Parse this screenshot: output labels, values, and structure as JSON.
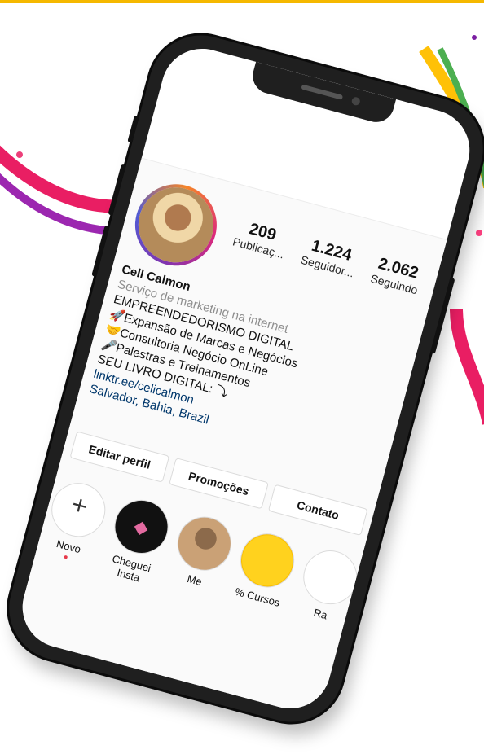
{
  "colors": {
    "border": "#f5b800",
    "phone": "#1f1f1f",
    "link": "#00376b",
    "muted": "#8e8e8e"
  },
  "profile": {
    "stats": [
      {
        "value": "209",
        "label": "Publicaç..."
      },
      {
        "value": "1.224",
        "label": "Seguidor..."
      },
      {
        "value": "2.062",
        "label": "Seguindo"
      }
    ],
    "name": "Cell Calmon",
    "category": "Serviço de marketing na internet",
    "bio_lines": [
      "EMPREENDEDORISMO DIGITAL",
      "Expansão de Marcas e Negócios",
      "Consultoria Negócio OnLine",
      "Palestras e Treinamentos",
      "SEU LIVRO DIGITAL:"
    ],
    "link": "linktr.ee/celicalmon",
    "location": "Salvador, Bahia, Brazil"
  },
  "actions": [
    "Editar perfil",
    "Promoções",
    "Contato"
  ],
  "highlights": [
    {
      "label": "Novo",
      "icon": "plus-icon"
    },
    {
      "label": "Cheguei Insta",
      "icon": "dark-logo-icon"
    },
    {
      "label": "Me",
      "icon": "photo-icon"
    },
    {
      "label": "% Cursos",
      "icon": "emoji-icon"
    },
    {
      "label": "Ra",
      "icon": "partial-icon"
    }
  ]
}
